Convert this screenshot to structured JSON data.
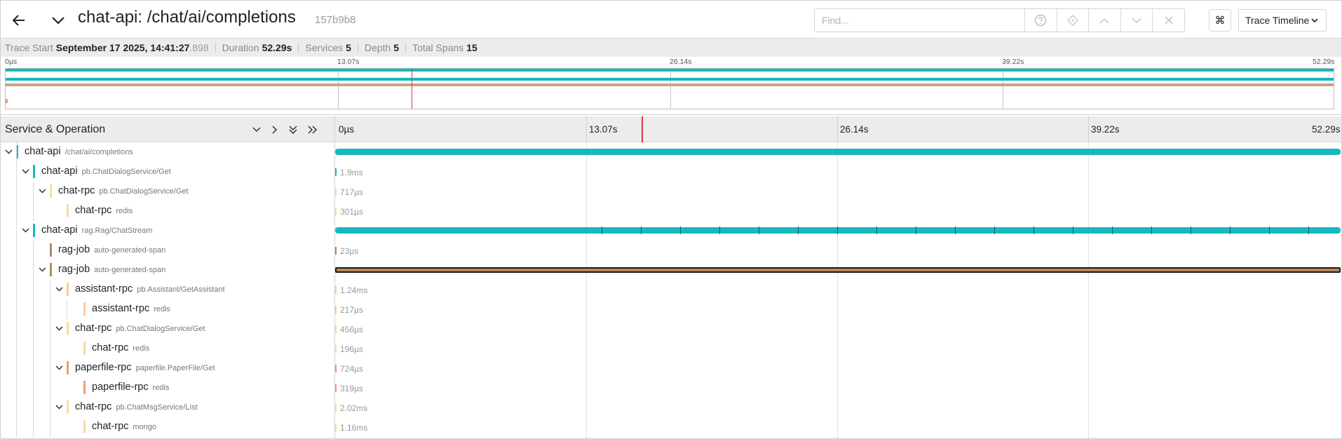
{
  "header": {
    "title": "chat-api: /chat/ai/completions",
    "trace_id": "157b9b8",
    "find_placeholder": "Find...",
    "kbd_label": "⌘",
    "view_label": "Trace Timeline"
  },
  "meta": {
    "trace_start_label": "Trace Start",
    "trace_start_value": "September 17 2025, 14:41:27",
    "trace_start_ms": ".898",
    "duration_label": "Duration",
    "duration_value": "52.29s",
    "services_label": "Services",
    "services_value": "5",
    "depth_label": "Depth",
    "depth_value": "5",
    "total_spans_label": "Total Spans",
    "total_spans_value": "15"
  },
  "timeline": {
    "ticks": [
      "0µs",
      "13.07s",
      "26.14s",
      "39.22s",
      "52.29s"
    ]
  },
  "left_panel": {
    "title": "Service & Operation"
  },
  "colors": {
    "chat-api": "#17b8be",
    "chat-rpc": "#f8dca1",
    "rag-job": "#b7885e",
    "assistant-rpc": "#ffcb99",
    "paperfile-rpc": "#f89570",
    "cursor": "#e8333c"
  },
  "spans": [
    {
      "service": "chat-api",
      "operation": "/chat/ai/completions",
      "depth": 0,
      "has_toggle": true,
      "duration_label": "",
      "start_frac": 0.0,
      "width_frac": 1.0,
      "bar_color": "#17b8be",
      "kind": "full"
    },
    {
      "service": "chat-api",
      "operation": "pb.ChatDialogService/Get",
      "depth": 1,
      "has_toggle": true,
      "duration_label": "1.9ms",
      "start_frac": 0.0,
      "width_frac": 0.0,
      "bar_color": "#17b8be",
      "kind": "tiny"
    },
    {
      "service": "chat-rpc",
      "operation": "pb.ChatDialogService/Get",
      "depth": 2,
      "has_toggle": true,
      "duration_label": "717µs",
      "start_frac": 0.0,
      "width_frac": 0.0,
      "bar_color": "#f8dca1",
      "kind": "tiny"
    },
    {
      "service": "chat-rpc",
      "operation": "redis",
      "depth": 3,
      "has_toggle": false,
      "duration_label": "301µs",
      "start_frac": 0.0,
      "width_frac": 0.0,
      "bar_color": "#f8dca1",
      "kind": "tiny"
    },
    {
      "service": "chat-api",
      "operation": "rag.Rag/ChatStream",
      "depth": 1,
      "has_toggle": true,
      "duration_label": "",
      "start_frac": 0.0,
      "width_frac": 1.0,
      "bar_color": "#17b8be",
      "kind": "ticked"
    },
    {
      "service": "rag-job",
      "operation": "auto-generated-span",
      "depth": 2,
      "has_toggle": false,
      "duration_label": "23µs",
      "start_frac": 0.0,
      "width_frac": 0.0,
      "bar_color": "#b7885e",
      "kind": "tiny"
    },
    {
      "service": "rag-job",
      "operation": "auto-generated-span",
      "depth": 2,
      "has_toggle": true,
      "duration_label": "",
      "start_frac": 0.0,
      "width_frac": 1.0,
      "bar_color": "#b7885e",
      "kind": "dark"
    },
    {
      "service": "assistant-rpc",
      "operation": "pb.Assistant/GetAssistant",
      "depth": 3,
      "has_toggle": true,
      "duration_label": "1.24ms",
      "start_frac": 0.0,
      "width_frac": 0.0,
      "bar_color": "#ffcb99",
      "kind": "tiny"
    },
    {
      "service": "assistant-rpc",
      "operation": "redis",
      "depth": 4,
      "has_toggle": false,
      "duration_label": "217µs",
      "start_frac": 0.0,
      "width_frac": 0.0,
      "bar_color": "#ffcb99",
      "kind": "tiny"
    },
    {
      "service": "chat-rpc",
      "operation": "pb.ChatDialogService/Get",
      "depth": 3,
      "has_toggle": true,
      "duration_label": "456µs",
      "start_frac": 0.0,
      "width_frac": 0.0,
      "bar_color": "#f8dca1",
      "kind": "tiny"
    },
    {
      "service": "chat-rpc",
      "operation": "redis",
      "depth": 4,
      "has_toggle": false,
      "duration_label": "196µs",
      "start_frac": 0.0,
      "width_frac": 0.0,
      "bar_color": "#f8dca1",
      "kind": "tiny"
    },
    {
      "service": "paperfile-rpc",
      "operation": "paperfile.PaperFile/Get",
      "depth": 3,
      "has_toggle": true,
      "duration_label": "724µs",
      "start_frac": 0.0,
      "width_frac": 0.0,
      "bar_color": "#f89570",
      "kind": "tiny"
    },
    {
      "service": "paperfile-rpc",
      "operation": "redis",
      "depth": 4,
      "has_toggle": false,
      "duration_label": "319µs",
      "start_frac": 0.0,
      "width_frac": 0.0,
      "bar_color": "#f89570",
      "kind": "tiny"
    },
    {
      "service": "chat-rpc",
      "operation": "pb.ChatMsgService/List",
      "depth": 3,
      "has_toggle": true,
      "duration_label": "2.02ms",
      "start_frac": 0.0,
      "width_frac": 0.0,
      "bar_color": "#f8dca1",
      "kind": "tiny"
    },
    {
      "service": "chat-rpc",
      "operation": "mongo",
      "depth": 4,
      "has_toggle": false,
      "duration_label": "1.16ms",
      "start_frac": 0.0,
      "width_frac": 0.0,
      "bar_color": "#f8dca1",
      "kind": "tiny"
    }
  ]
}
